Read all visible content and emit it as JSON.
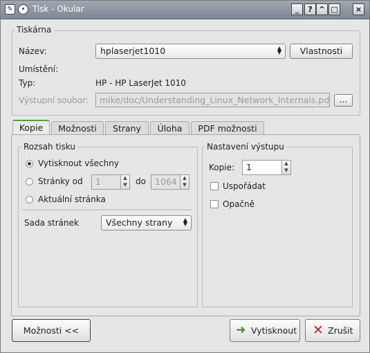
{
  "window": {
    "title": "Tisk - Okular"
  },
  "printer_group": {
    "legend": "Tiskárna",
    "name_label": "Název:",
    "name_value": "hplaserjet1010",
    "properties_button": "Vlastnosti",
    "location_label": "Umístění:",
    "location_value": "",
    "type_label": "Typ:",
    "type_value": "HP - HP LaserJet 1010",
    "output_file_label": "Výstupní soubor:",
    "output_file_value": "mike/doc/Understanding_Linux_Network_Internals.pdf",
    "browse_button": "..."
  },
  "tabs": [
    "Kopie",
    "Možnosti",
    "Strany",
    "Úloha",
    "PDF možnosti"
  ],
  "range_group": {
    "legend": "Rozsah tisku",
    "all_label": "Vytisknout všechny",
    "pages_label": "Stránky od",
    "from_value": "1",
    "to_label": "do",
    "to_value": "1064",
    "current_label": "Aktuální stránka",
    "page_set_label": "Sada stránek",
    "page_set_value": "Všechny strany"
  },
  "output_group": {
    "legend": "Nastavení výstupu",
    "copies_label": "Kopie:",
    "copies_value": "1",
    "collate_label": "Uspořádat",
    "reverse_label": "Opačně"
  },
  "footer": {
    "options_button": "Možnosti <<",
    "print_button": "Vytisknout",
    "cancel_button": "Zrušit"
  }
}
